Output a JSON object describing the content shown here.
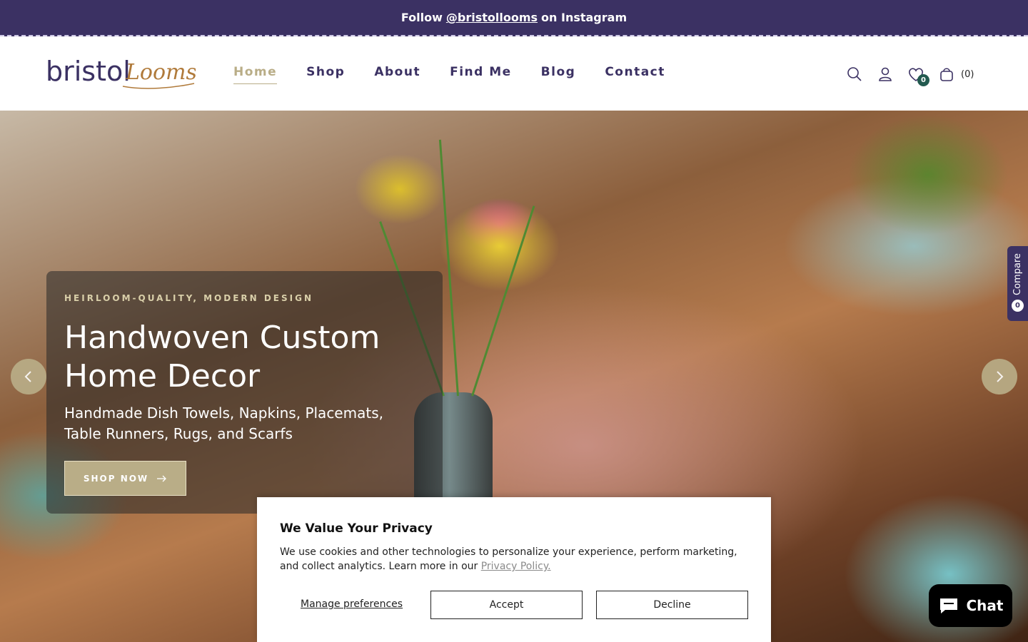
{
  "announcement": {
    "prefix": "Follow",
    "handle": "@bristollooms",
    "suffix": "on Instagram"
  },
  "brand": {
    "name_part1": "bristol",
    "name_part2": "Looms"
  },
  "nav": {
    "items": [
      {
        "label": "Home"
      },
      {
        "label": "Shop"
      },
      {
        "label": "About"
      },
      {
        "label": "Find Me"
      },
      {
        "label": "Blog"
      },
      {
        "label": "Contact"
      }
    ]
  },
  "tools": {
    "wishlist_count": "0",
    "cart_count": "(0)"
  },
  "hero": {
    "eyebrow": "HEIRLOOM-QUALITY, MODERN DESIGN",
    "title": "Handwoven Custom Home Decor",
    "subtitle": "Handmade Dish Towels, Napkins, Placemats, Table Runners, Rugs, and Scarfs",
    "button_label": "SHOP NOW"
  },
  "compare": {
    "label": "Compare",
    "count": "0"
  },
  "cookie": {
    "title": "We Value Your Privacy",
    "text": "We use cookies and other technologies to personalize your experience, perform marketing, and collect analytics. Learn more in our",
    "link": "Privacy Policy.",
    "manage": "Manage preferences",
    "accept": "Accept",
    "decline": "Decline"
  },
  "chat": {
    "label": "Chat"
  },
  "colors": {
    "brand_purple": "#3b3163",
    "accent_gold": "#b9ad87",
    "badge_green": "#225a4f"
  }
}
